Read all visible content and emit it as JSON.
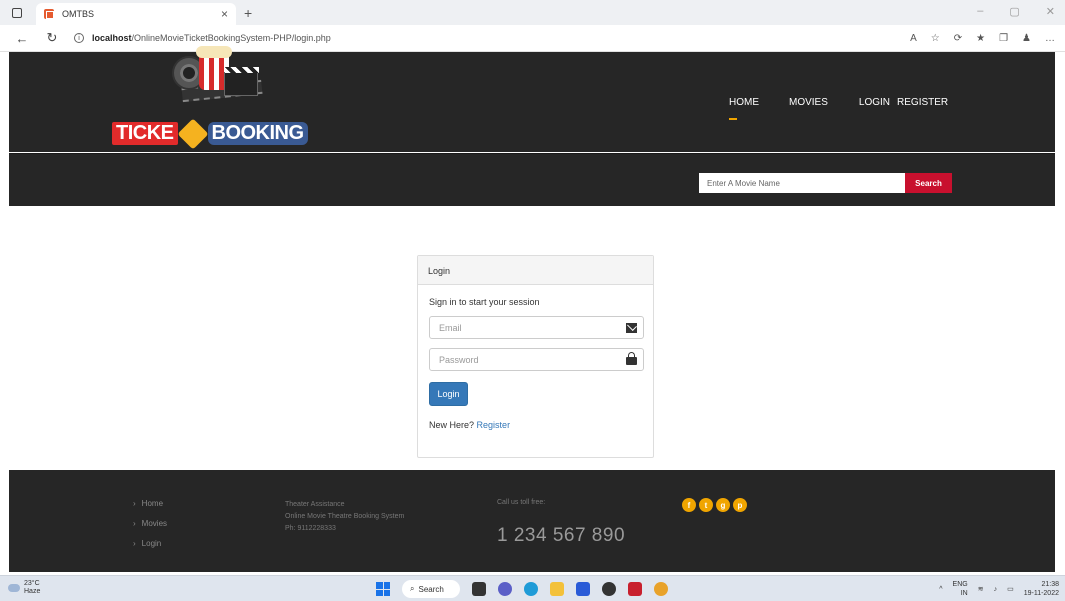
{
  "browser": {
    "tab_title": "OMTBS",
    "tab_close": "×",
    "new_tab": "+",
    "url_host": "localhost",
    "url_path": "/OnlineMovieTicketBookingSystem-PHP/login.php"
  },
  "logo": {
    "part1": "TICKE",
    "part2": "BOOKING"
  },
  "nav": {
    "home": "HOME",
    "movies": "MOVIES",
    "login": "LOGIN",
    "register": "REGISTER"
  },
  "search": {
    "placeholder": "Enter A Movie Name",
    "button": "Search"
  },
  "login_panel": {
    "heading": "Login",
    "subtitle": "Sign in to start your session",
    "email_placeholder": "Email",
    "password_placeholder": "Password",
    "button": "Login",
    "new_here": "New Here?",
    "register_link": "Register"
  },
  "footer": {
    "links": [
      "Home",
      "Movies",
      "Login"
    ],
    "assistance_title": "Theater Assistance",
    "assistance_name": "Online Movie Theatre Booking System",
    "assistance_phone": "Ph: 9112228333",
    "call_label": "Call us toll free:",
    "phone": "1 234 567 890",
    "social": [
      "f",
      "t",
      "g",
      "p"
    ]
  },
  "taskbar": {
    "temperature": "23°C",
    "condition": "Haze",
    "search": "Search",
    "lang1": "ENG",
    "lang2": "IN",
    "time": "21:38",
    "date": "19-11-2022"
  },
  "colors": {
    "accent": "#f0a500",
    "search_button": "#c8102e",
    "login_button": "#3578b8",
    "header_bg": "#262626"
  }
}
